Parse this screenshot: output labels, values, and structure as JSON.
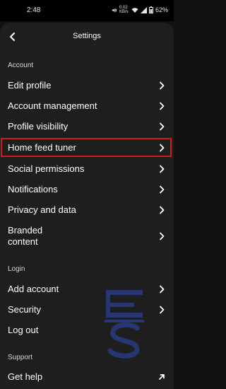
{
  "status": {
    "time": "2:48",
    "speed": "0.02\nKB/s",
    "battery": "62%"
  },
  "header": {
    "title": "Settings"
  },
  "sections": {
    "account": "Account",
    "login": "Login",
    "support": "Support"
  },
  "items": {
    "edit_profile": "Edit profile",
    "account_management": "Account management",
    "profile_visibility": "Profile visibility",
    "home_feed_tuner": "Home feed tuner",
    "social_permissions": "Social permissions",
    "notifications": "Notifications",
    "privacy_and_data": "Privacy and data",
    "branded_content_1": "Branded",
    "branded_content_2": "content",
    "add_account": "Add account",
    "security": "Security",
    "log_out": "Log out",
    "get_help": "Get help"
  },
  "icons": {
    "back": "chevron-left-icon",
    "row": "chevron-right-icon",
    "external": "arrow-up-right-icon"
  },
  "colors": {
    "highlight": "#d41a1a",
    "background": "#1e1e1e",
    "watermark": "#2a3f8c"
  }
}
